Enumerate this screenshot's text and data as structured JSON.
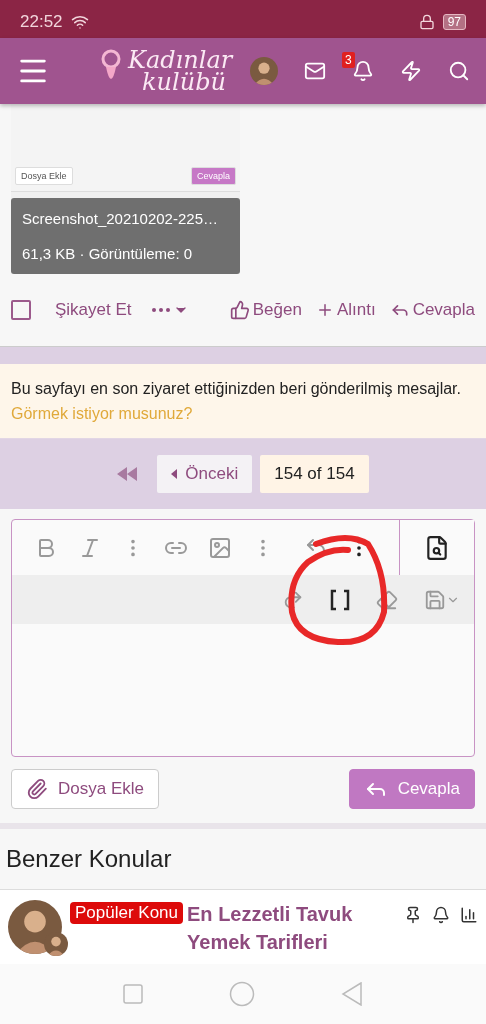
{
  "status_bar": {
    "time": "22:52",
    "battery": "97"
  },
  "header": {
    "logo_line_1": "Kadınlar",
    "logo_line_2": "kulübü",
    "notification_count": "3"
  },
  "post": {
    "attachment": {
      "preview_buttons": [
        "Dosya Ekle",
        "Cevapla"
      ],
      "filename": "Screenshot_20210202-225…",
      "meta": "61,3 KB · Görüntüleme: 0"
    },
    "select_checked": false,
    "actions": [
      {
        "kind": "report",
        "label": "Şikayet Et"
      },
      {
        "kind": "more"
      },
      {
        "kind": "like",
        "label": "Beğen"
      },
      {
        "kind": "quote",
        "label": "Alıntı"
      },
      {
        "kind": "reply",
        "label": "Cevapla"
      }
    ]
  },
  "notice": {
    "text": "Bu sayfayı en son ziyaret ettiğinizden beri gönderilmiş mesajlar.",
    "link": "Görmek istiyor musunuz?"
  },
  "pagination": {
    "previous": "Önceki",
    "current": "154 of 154"
  },
  "editor": {
    "buttons": [
      {
        "kind": "attach",
        "label": "Dosya Ekle"
      },
      {
        "kind": "submit",
        "label": "Cevapla"
      }
    ]
  },
  "similar": {
    "title": "Benzer Konular",
    "threads": [
      {
        "badge": "Popüler Konu",
        "title": "En Lezzetli Tavuk Yemek Tarifleri"
      }
    ]
  }
}
